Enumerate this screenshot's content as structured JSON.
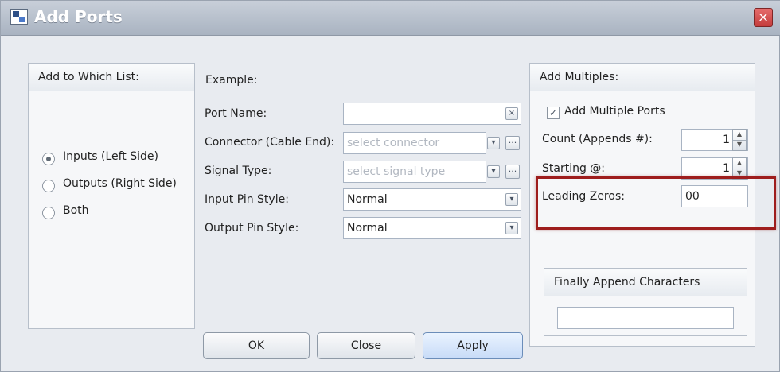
{
  "window": {
    "title": "Add Ports",
    "close_glyph": "×"
  },
  "left_panel": {
    "heading": "Add to Which List:",
    "options": [
      {
        "label": "Inputs (Left Side)",
        "selected": true
      },
      {
        "label": "Outputs (Right Side)",
        "selected": false
      },
      {
        "label": "Both",
        "selected": false
      }
    ]
  },
  "middle": {
    "example_label": "Example:",
    "fields": {
      "port_name": {
        "label": "Port Name:",
        "value": "",
        "clear_glyph": "×"
      },
      "connector": {
        "label": "Connector (Cable End):",
        "placeholder": "select connector"
      },
      "signal_type": {
        "label": "Signal Type:",
        "placeholder": "select signal type"
      },
      "input_pin_style": {
        "label": "Input Pin Style:",
        "value": "Normal"
      },
      "output_pin_style": {
        "label": "Output Pin Style:",
        "value": "Normal"
      }
    }
  },
  "right_panel": {
    "heading": "Add Multiples:",
    "add_multiple": {
      "label": "Add Multiple Ports",
      "checked": true
    },
    "count": {
      "label": "Count (Appends #):",
      "value": "1"
    },
    "starting": {
      "label": "Starting @:",
      "value": "1"
    },
    "leading_zeros": {
      "label": "Leading Zeros:",
      "value": "00"
    },
    "finally_append": {
      "heading": "Finally Append Characters",
      "value": ""
    }
  },
  "buttons": {
    "ok": "OK",
    "close": "Close",
    "apply": "Apply"
  },
  "icons": {
    "dropdown_glyph": "▾",
    "more_glyph": "···",
    "spin_up_glyph": "▲",
    "spin_down_glyph": "▼",
    "check_glyph": "✓"
  },
  "colors": {
    "highlight_border": "#9e1d1d",
    "title_text": "#ffffff"
  }
}
